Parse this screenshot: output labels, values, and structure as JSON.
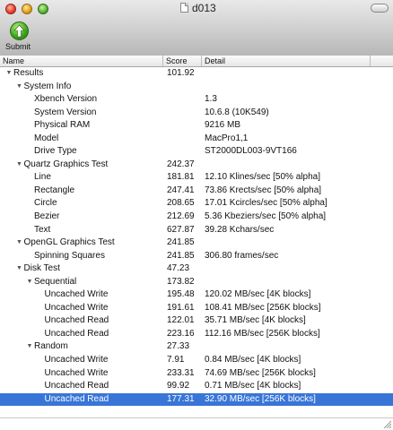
{
  "window": {
    "title": "d013"
  },
  "toolbar": {
    "submit_label": "Submit"
  },
  "columns": {
    "name": "Name",
    "score": "Score",
    "detail": "Detail"
  },
  "rows": [
    {
      "level": 0,
      "expander": "open",
      "name": "Results",
      "score": "101.92",
      "detail": ""
    },
    {
      "level": 1,
      "expander": "open",
      "name": "System Info",
      "score": "",
      "detail": ""
    },
    {
      "level": 2,
      "expander": "none",
      "name": "Xbench Version",
      "score": "",
      "detail": "1.3"
    },
    {
      "level": 2,
      "expander": "none",
      "name": "System Version",
      "score": "",
      "detail": "10.6.8 (10K549)"
    },
    {
      "level": 2,
      "expander": "none",
      "name": "Physical RAM",
      "score": "",
      "detail": "9216 MB"
    },
    {
      "level": 2,
      "expander": "none",
      "name": "Model",
      "score": "",
      "detail": "MacPro1,1"
    },
    {
      "level": 2,
      "expander": "none",
      "name": "Drive Type",
      "score": "",
      "detail": "ST2000DL003-9VT166"
    },
    {
      "level": 1,
      "expander": "open",
      "name": "Quartz Graphics Test",
      "score": "242.37",
      "detail": ""
    },
    {
      "level": 2,
      "expander": "none",
      "name": "Line",
      "score": "181.81",
      "detail": "12.10 Klines/sec [50% alpha]"
    },
    {
      "level": 2,
      "expander": "none",
      "name": "Rectangle",
      "score": "247.41",
      "detail": "73.86 Krects/sec [50% alpha]"
    },
    {
      "level": 2,
      "expander": "none",
      "name": "Circle",
      "score": "208.65",
      "detail": "17.01 Kcircles/sec [50% alpha]"
    },
    {
      "level": 2,
      "expander": "none",
      "name": "Bezier",
      "score": "212.69",
      "detail": "5.36 Kbeziers/sec [50% alpha]"
    },
    {
      "level": 2,
      "expander": "none",
      "name": "Text",
      "score": "627.87",
      "detail": "39.28 Kchars/sec"
    },
    {
      "level": 1,
      "expander": "open",
      "name": "OpenGL Graphics Test",
      "score": "241.85",
      "detail": ""
    },
    {
      "level": 2,
      "expander": "none",
      "name": "Spinning Squares",
      "score": "241.85",
      "detail": "306.80 frames/sec"
    },
    {
      "level": 1,
      "expander": "open",
      "name": "Disk Test",
      "score": "47.23",
      "detail": ""
    },
    {
      "level": 2,
      "expander": "open",
      "name": "Sequential",
      "score": "173.82",
      "detail": ""
    },
    {
      "level": 3,
      "expander": "none",
      "name": "Uncached Write",
      "score": "195.48",
      "detail": "120.02 MB/sec [4K blocks]"
    },
    {
      "level": 3,
      "expander": "none",
      "name": "Uncached Write",
      "score": "191.61",
      "detail": "108.41 MB/sec [256K blocks]"
    },
    {
      "level": 3,
      "expander": "none",
      "name": "Uncached Read",
      "score": "122.01",
      "detail": "35.71 MB/sec [4K blocks]"
    },
    {
      "level": 3,
      "expander": "none",
      "name": "Uncached Read",
      "score": "223.16",
      "detail": "112.16 MB/sec [256K blocks]"
    },
    {
      "level": 2,
      "expander": "open",
      "name": "Random",
      "score": "27.33",
      "detail": ""
    },
    {
      "level": 3,
      "expander": "none",
      "name": "Uncached Write",
      "score": "7.91",
      "detail": "0.84 MB/sec [4K blocks]"
    },
    {
      "level": 3,
      "expander": "none",
      "name": "Uncached Write",
      "score": "233.31",
      "detail": "74.69 MB/sec [256K blocks]"
    },
    {
      "level": 3,
      "expander": "none",
      "name": "Uncached Read",
      "score": "99.92",
      "detail": "0.71 MB/sec [4K blocks]"
    },
    {
      "level": 3,
      "expander": "none",
      "name": "Uncached Read",
      "score": "177.31",
      "detail": "32.90 MB/sec [256K blocks]",
      "selected": true
    }
  ],
  "colors": {
    "selection": "#3875d7",
    "submit_green": "#3fa91f"
  },
  "icons": {
    "close": "close-icon",
    "minimize": "minimize-icon",
    "zoom": "zoom-icon",
    "document": "document-icon",
    "submit": "upload-arrow-icon",
    "expanded": "disclosure-triangle-down-icon"
  }
}
